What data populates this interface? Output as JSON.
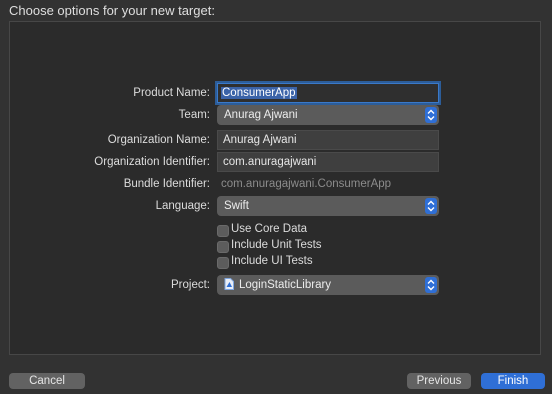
{
  "header": {
    "title": "Choose options for your new target:"
  },
  "form": {
    "product_name": {
      "label": "Product Name:",
      "value": "ConsumerApp"
    },
    "team": {
      "label": "Team:",
      "value": "Anurag Ajwani"
    },
    "organization_name": {
      "label": "Organization Name:",
      "value": "Anurag Ajwani"
    },
    "organization_identifier": {
      "label": "Organization Identifier:",
      "value": "com.anuragajwani"
    },
    "bundle_identifier": {
      "label": "Bundle Identifier:",
      "value": "com.anuragajwani.ConsumerApp"
    },
    "language": {
      "label": "Language:",
      "value": "Swift"
    },
    "options": [
      {
        "label": "Use Core Data",
        "checked": false
      },
      {
        "label": "Include Unit Tests",
        "checked": false
      },
      {
        "label": "Include UI Tests",
        "checked": false
      }
    ],
    "project": {
      "label": "Project:",
      "value": "LoginStaticLibrary",
      "icon": "project-file-icon"
    }
  },
  "footer": {
    "cancel_label": "Cancel",
    "previous_label": "Previous",
    "finish_label": "Finish"
  },
  "colors": {
    "background": "#323232",
    "panel": "#2b2b2b",
    "accent": "#2f6fd6",
    "focus_ring": "#3a79c9",
    "popup": "#5b5b5b"
  }
}
